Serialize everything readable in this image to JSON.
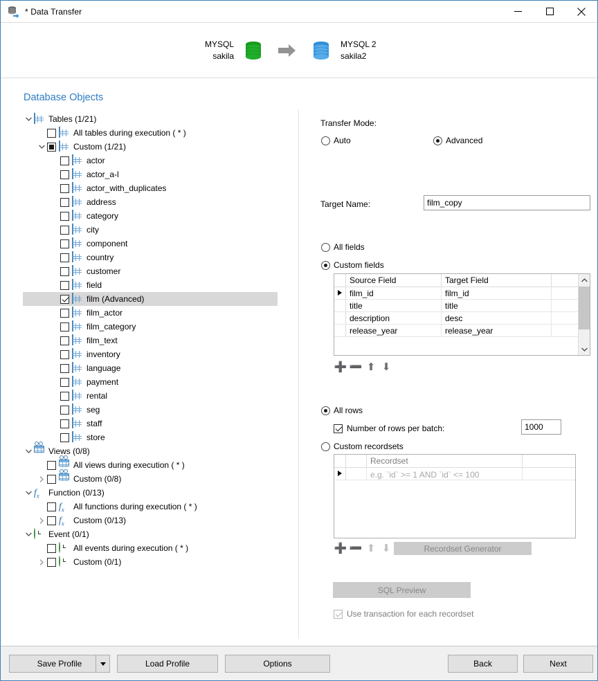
{
  "window": {
    "title": "* Data Transfer",
    "icon": "data-transfer-icon",
    "minimize": "—",
    "maximize": "□",
    "close": "×"
  },
  "connection": {
    "source": {
      "engine": "MYSQL",
      "database": "sakila",
      "color": "#1a9c2e"
    },
    "target": {
      "engine": "MYSQL 2",
      "database": "sakila2",
      "color": "#46a3e8"
    },
    "arrow": "arrow-right-icon"
  },
  "section": {
    "title": "Database Objects"
  },
  "tree": [
    {
      "indent": 0,
      "twisty": "down",
      "checkbox": "none",
      "icon": "table-icon",
      "label": "Tables (1/21)",
      "selected": false
    },
    {
      "indent": 1,
      "twisty": "none",
      "checkbox": "unchecked",
      "icon": "table-icon",
      "label": "All tables during execution ( * )",
      "selected": false
    },
    {
      "indent": 1,
      "twisty": "down",
      "checkbox": "partial",
      "icon": "table-icon",
      "label": "Custom (1/21)",
      "selected": false
    },
    {
      "indent": 2,
      "twisty": "none",
      "checkbox": "unchecked",
      "icon": "table-icon",
      "label": "actor",
      "selected": false
    },
    {
      "indent": 2,
      "twisty": "none",
      "checkbox": "unchecked",
      "icon": "table-icon",
      "label": "actor_a-l",
      "selected": false
    },
    {
      "indent": 2,
      "twisty": "none",
      "checkbox": "unchecked",
      "icon": "table-icon",
      "label": "actor_with_duplicates",
      "selected": false
    },
    {
      "indent": 2,
      "twisty": "none",
      "checkbox": "unchecked",
      "icon": "table-icon",
      "label": "address",
      "selected": false
    },
    {
      "indent": 2,
      "twisty": "none",
      "checkbox": "unchecked",
      "icon": "table-icon",
      "label": "category",
      "selected": false
    },
    {
      "indent": 2,
      "twisty": "none",
      "checkbox": "unchecked",
      "icon": "table-icon",
      "label": "city",
      "selected": false
    },
    {
      "indent": 2,
      "twisty": "none",
      "checkbox": "unchecked",
      "icon": "table-icon",
      "label": "component",
      "selected": false
    },
    {
      "indent": 2,
      "twisty": "none",
      "checkbox": "unchecked",
      "icon": "table-icon",
      "label": "country",
      "selected": false
    },
    {
      "indent": 2,
      "twisty": "none",
      "checkbox": "unchecked",
      "icon": "table-icon",
      "label": "customer",
      "selected": false
    },
    {
      "indent": 2,
      "twisty": "none",
      "checkbox": "unchecked",
      "icon": "table-icon",
      "label": "field",
      "selected": false
    },
    {
      "indent": 2,
      "twisty": "none",
      "checkbox": "checked",
      "icon": "table-icon",
      "label": "film (Advanced)",
      "selected": true
    },
    {
      "indent": 2,
      "twisty": "none",
      "checkbox": "unchecked",
      "icon": "table-icon",
      "label": "film_actor",
      "selected": false
    },
    {
      "indent": 2,
      "twisty": "none",
      "checkbox": "unchecked",
      "icon": "table-icon",
      "label": "film_category",
      "selected": false
    },
    {
      "indent": 2,
      "twisty": "none",
      "checkbox": "unchecked",
      "icon": "table-icon",
      "label": "film_text",
      "selected": false
    },
    {
      "indent": 2,
      "twisty": "none",
      "checkbox": "unchecked",
      "icon": "table-icon",
      "label": "inventory",
      "selected": false
    },
    {
      "indent": 2,
      "twisty": "none",
      "checkbox": "unchecked",
      "icon": "table-icon",
      "label": "language",
      "selected": false
    },
    {
      "indent": 2,
      "twisty": "none",
      "checkbox": "unchecked",
      "icon": "table-icon",
      "label": "payment",
      "selected": false
    },
    {
      "indent": 2,
      "twisty": "none",
      "checkbox": "unchecked",
      "icon": "table-icon",
      "label": "rental",
      "selected": false
    },
    {
      "indent": 2,
      "twisty": "none",
      "checkbox": "unchecked",
      "icon": "table-icon",
      "label": "seg",
      "selected": false
    },
    {
      "indent": 2,
      "twisty": "none",
      "checkbox": "unchecked",
      "icon": "table-icon",
      "label": "staff",
      "selected": false
    },
    {
      "indent": 2,
      "twisty": "none",
      "checkbox": "unchecked",
      "icon": "table-icon",
      "label": "store",
      "selected": false
    },
    {
      "indent": 0,
      "twisty": "down",
      "checkbox": "none",
      "icon": "view-icon",
      "label": "Views (0/8)",
      "selected": false
    },
    {
      "indent": 1,
      "twisty": "none",
      "checkbox": "unchecked",
      "icon": "view-icon",
      "label": "All views during execution ( * )",
      "selected": false
    },
    {
      "indent": 1,
      "twisty": "right",
      "checkbox": "unchecked",
      "icon": "view-icon",
      "label": "Custom (0/8)",
      "selected": false
    },
    {
      "indent": 0,
      "twisty": "down",
      "checkbox": "none",
      "icon": "function-icon",
      "label": "Function (0/13)",
      "selected": false
    },
    {
      "indent": 1,
      "twisty": "none",
      "checkbox": "unchecked",
      "icon": "function-icon",
      "label": "All functions during execution ( * )",
      "selected": false
    },
    {
      "indent": 1,
      "twisty": "right",
      "checkbox": "unchecked",
      "icon": "function-icon",
      "label": "Custom (0/13)",
      "selected": false
    },
    {
      "indent": 0,
      "twisty": "down",
      "checkbox": "none",
      "icon": "event-icon",
      "label": "Event (0/1)",
      "selected": false
    },
    {
      "indent": 1,
      "twisty": "none",
      "checkbox": "unchecked",
      "icon": "event-icon",
      "label": "All events during execution ( * )",
      "selected": false
    },
    {
      "indent": 1,
      "twisty": "right",
      "checkbox": "unchecked",
      "icon": "event-icon",
      "label": "Custom (0/1)",
      "selected": false
    }
  ],
  "panel": {
    "transfer_mode_label": "Transfer Mode:",
    "mode_auto": "Auto",
    "mode_advanced": "Advanced",
    "mode_selected": "Advanced",
    "target_name_label": "Target Name:",
    "target_name_value": "film_copy",
    "all_fields_label": "All fields",
    "custom_fields_label": "Custom fields",
    "fields_selected": "Custom fields",
    "fields_columns": [
      "Source Field",
      "Target Field"
    ],
    "fields_rows": [
      {
        "source": "film_id",
        "target": "film_id",
        "current": true
      },
      {
        "source": "title",
        "target": "title",
        "current": false
      },
      {
        "source": "description",
        "target": "desc",
        "current": false
      },
      {
        "source": "release_year",
        "target": "release_year",
        "current": false
      }
    ],
    "field_tools": [
      "add-icon",
      "remove-icon",
      "move-up-icon",
      "move-down-icon"
    ],
    "all_rows_label": "All rows",
    "rows_selected": "All rows",
    "batch_checkbox_label": "Number of rows per batch:",
    "batch_checked": true,
    "batch_value": "1000",
    "custom_recordsets_label": "Custom recordsets",
    "recordset_column": "Recordset",
    "recordset_placeholder": "e.g. `id` >= 1 AND `id` <= 100",
    "recordset_tools": [
      "add-icon",
      "remove-icon",
      "move-up-icon",
      "move-down-icon"
    ],
    "recordset_generator_label": "Recordset Generator",
    "sql_preview_label": "SQL Preview",
    "use_transaction_label": "Use transaction for each recordset",
    "use_transaction_checked": true
  },
  "footer": {
    "save_profile": "Save Profile",
    "load_profile": "Load Profile",
    "options": "Options",
    "back": "Back",
    "next": "Next"
  }
}
